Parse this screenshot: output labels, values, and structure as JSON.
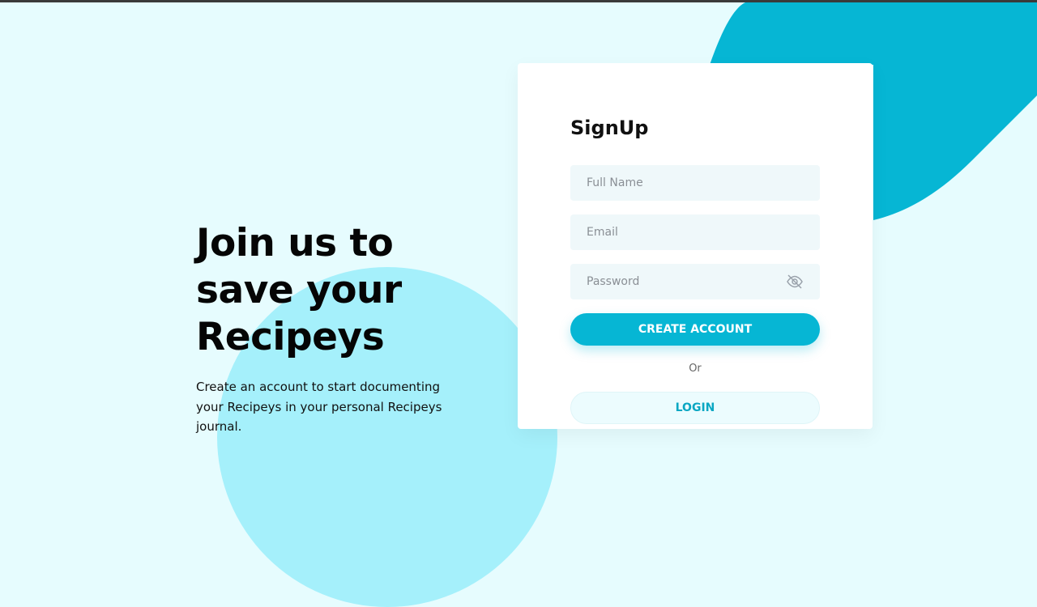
{
  "hero": {
    "title_line1": "Join us to",
    "title_line2": "save your",
    "title_line3": "Recipeys",
    "description": "Create an account to start documenting your Recipeys in your personal Recipeys journal."
  },
  "signup": {
    "title": "SignUp",
    "full_name_placeholder": "Full Name",
    "email_placeholder": "Email",
    "password_placeholder": "Password",
    "password_toggle_icon": "eye-off-icon",
    "create_account_label": "CREATE ACCOUNT",
    "or_label": "Or",
    "login_label": "LOGIN"
  },
  "colors": {
    "background": "#e6fcfe",
    "accent": "#06b6d4",
    "light_accent": "#a5f0fb",
    "card": "#ffffff"
  }
}
